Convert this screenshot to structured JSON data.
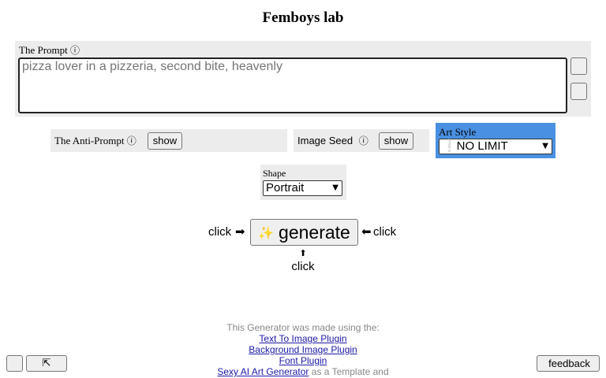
{
  "page": {
    "title": "Femboys lab"
  },
  "prompt": {
    "glyph": "",
    "label": "The Prompt",
    "info_glyph": "ⓘ",
    "placeholder": "pizza lover in a pizzeria, second bite, heavenly",
    "side_buttons": [
      "",
      ""
    ]
  },
  "anti_prompt": {
    "glyph": "",
    "label": "The Anti-Prompt",
    "glyph2": "",
    "info_glyph": "ⓘ",
    "button_label": "show"
  },
  "image_seed": {
    "glyph": "",
    "label": "Image Seed",
    "info_glyph": "ⓘ",
    "button_label": "show"
  },
  "art_style": {
    "glyph": "",
    "label": "Art Style",
    "selected": "❕NO LIMIT"
  },
  "shape": {
    "glyph": "",
    "label": "Shape",
    "selected": "Portrait"
  },
  "generate": {
    "click_left": "click",
    "arrow_right": "➡",
    "sparkle": "✨",
    "button_label": "generate",
    "arrow_left": "⬅",
    "click_right": "click",
    "arrow_up": "⬆",
    "click_bottom": "click"
  },
  "footer": {
    "made_with": "This Generator was made using the:",
    "links": [
      "Text To Image Plugin",
      "Background Image Plugin",
      "Font Plugin"
    ],
    "template_link": "Sexy AI Art Generator",
    "template_suffix": " as a Template and"
  },
  "corner_buttons": {
    "left_small": "",
    "left_wide": "⇱",
    "feedback_glyph": "",
    "feedback_label": "feedback"
  },
  "colors": {
    "art_style_bg": "#4a90e2",
    "panel_bg": "#ececec",
    "link": "#1a1aa6"
  }
}
